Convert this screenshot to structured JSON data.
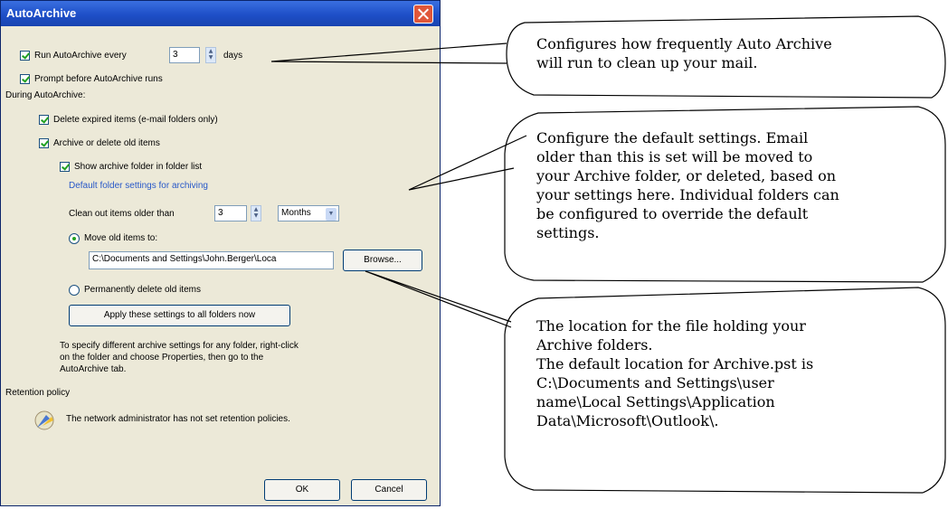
{
  "dialog": {
    "title": "AutoArchive",
    "run_every_label": "Run AutoArchive every",
    "run_every_value": "3",
    "run_every_unit": "days",
    "prompt_label": "Prompt before AutoArchive runs",
    "during_label": "During AutoArchive:",
    "delete_expired_label": "Delete expired items (e-mail folders only)",
    "archive_old_label": "Archive or delete old items",
    "show_folder_label": "Show archive folder in folder list",
    "default_settings_label": "Default folder settings for archiving",
    "clean_older_label": "Clean out items older than",
    "clean_older_value": "3",
    "clean_older_unit": "Months",
    "move_old_label": "Move old items to:",
    "move_path": "C:\\Documents and Settings\\John.Berger\\Loca",
    "browse_label": "Browse...",
    "delete_perm_label": "Permanently delete old items",
    "apply_label": "Apply these settings to all folders now",
    "info_line1": "To specify different archive settings for any folder, right-click",
    "info_line2": "on the folder and choose Properties, then go to the",
    "info_line3": "AutoArchive tab.",
    "retention_label": "Retention policy",
    "retention_text": "The network administrator has not set retention policies.",
    "ok_label": "OK",
    "cancel_label": "Cancel"
  },
  "callouts": {
    "c1": [
      "Configures how frequently Auto Archive",
      "will run to clean up your mail."
    ],
    "c2": [
      "Configure the default settings. Email",
      "older than this is set will be moved to",
      "your Archive folder, or deleted, based on",
      "your settings here.  Individual folders can",
      "be configured to override the default",
      "settings."
    ],
    "c3": [
      "The location for the file holding your",
      "Archive folders.",
      "The default location for Archive.pst is",
      "C:\\Documents and Settings\\user",
      "name\\Local Settings\\Application",
      "Data\\Microsoft\\Outlook\\."
    ]
  }
}
